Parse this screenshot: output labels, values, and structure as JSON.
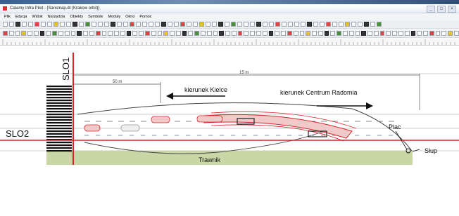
{
  "window": {
    "title": "Calamy Infra Pilot - [Sansmap.dt (Krakow orbit)]",
    "controls": [
      "_",
      "□",
      "×"
    ]
  },
  "menu": [
    "Plik",
    "Edycja",
    "Widok",
    "Narzędzia",
    "Obiekty",
    "Symbole",
    "Moduły",
    "Okno",
    "Pomoc"
  ],
  "drawing": {
    "label_slo1": "SLO1",
    "label_slo2": "SLO2",
    "label_kielce": "kierunek Kielce",
    "label_radom": "kierunek Centrum Radomia",
    "label_trawnik": "Trawnik",
    "label_plac": "Plac",
    "label_slup": "Słup",
    "dim_top": "15 m",
    "dim_second": "50 m",
    "colors": {
      "red_line": "#d9242a",
      "grass": "#c9d6a6",
      "ruler_line": "#9a9a9a"
    }
  }
}
